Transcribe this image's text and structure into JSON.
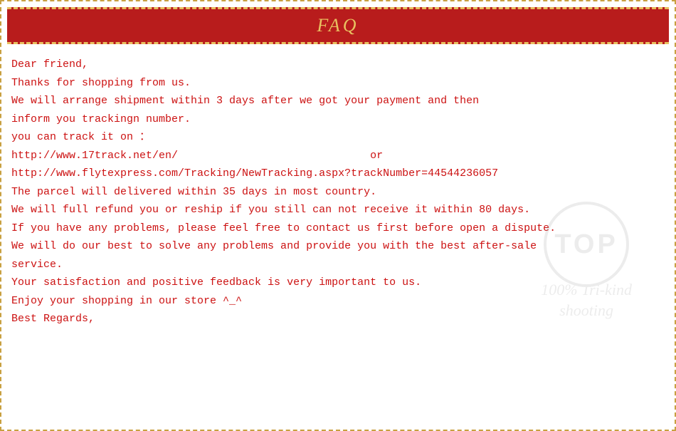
{
  "header": {
    "title": "FAQ"
  },
  "content": {
    "lines": [
      "Dear friend,",
      "Thanks for shopping from us.",
      "We will arrange shipment within 3 days after we got your payment and then",
      "inform you trackingn number.",
      "you can track it on ：",
      "http://www.17track.net/en/                              or",
      "http://www.flytexpress.com/Tracking/NewTracking.aspx?trackNumber=44544236057",
      "The parcel will delivered within 35 days in most country.",
      "We will full refund you or reship if you still can not receive it within 80 days.",
      "If you have any problems, please feel free to contact us first before open a dispute.",
      "We will do our best to solve any problems and provide you with the best after-sale",
      "service.",
      "Your satisfaction and positive feedback is very important to us.",
      "Enjoy your shopping in our store ^_^",
      "Best Regards,"
    ]
  },
  "watermark": {
    "circle_text": "TOP",
    "bottom_text": "100% Tri-kind\nshooting"
  }
}
